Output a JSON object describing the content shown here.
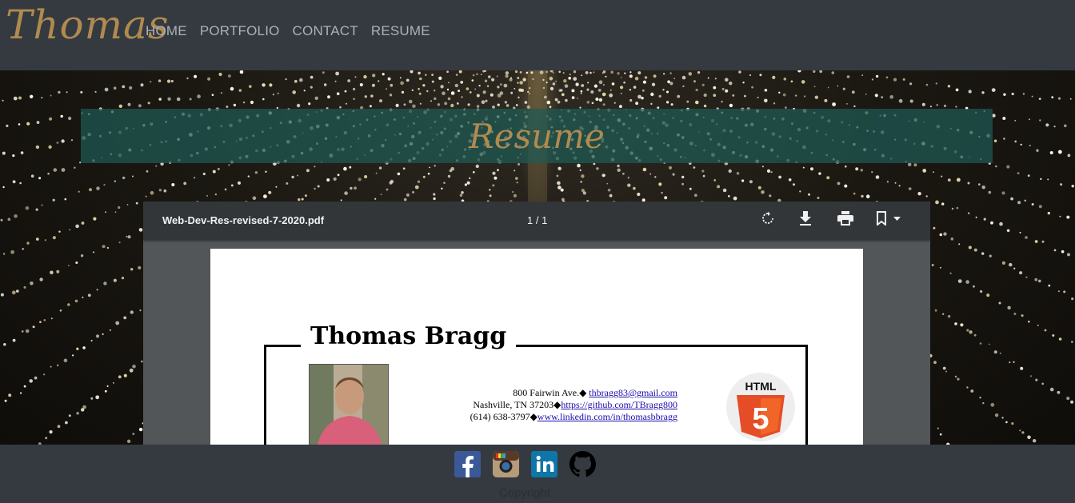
{
  "navbar": {
    "brand": "Thomas",
    "links": [
      "HOME",
      "PORTFOLIO",
      "CONTACT",
      "RESUME"
    ]
  },
  "banner": {
    "title": "Resume"
  },
  "pdf_viewer": {
    "file_name": "Web-Dev-Res-revised-7-2020.pdf",
    "page_indicator": "1 / 1",
    "toolbar_icons": [
      "rotate-icon",
      "download-icon",
      "print-icon",
      "bookmark-icon"
    ]
  },
  "resume": {
    "name": "Thomas Bragg",
    "address_line": "800 Fairwin Ave.◆ ",
    "email": "thbragg83@gmail.com",
    "city_line": "Nashville, TN 37203◆",
    "github": "https://github.com/TBragg800",
    "phone_line": "(614) 638-3797◆",
    "linkedin": "www.linkedin.com/in/thomasbbragg",
    "badge_text": "HTML",
    "badge_digit": "5"
  },
  "footer": {
    "social_icons": [
      "facebook-icon",
      "instagram-icon",
      "linkedin-icon",
      "github-icon"
    ],
    "copyright": "Copyright"
  },
  "colors": {
    "navbar_bg": "#343a40",
    "brand_gold": "#b08a4f",
    "banner_teal": "#1e5a55",
    "pdf_toolbar": "#323639",
    "html5_orange": "#e44d26"
  }
}
